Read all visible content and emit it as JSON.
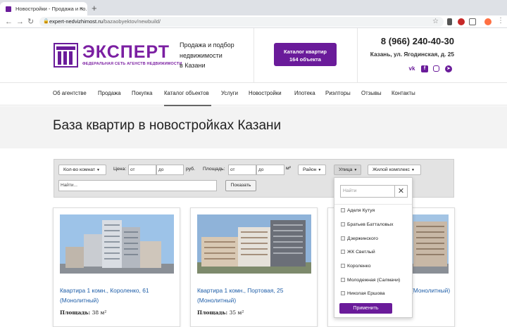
{
  "browser": {
    "tab_title": "Новостройки - Продажа и по...",
    "tab_close": "×",
    "new_tab": "+",
    "url_host": "expert-nedvizhimost.ru",
    "url_path": "/bazaobyektov/newbuild/"
  },
  "header": {
    "logo_name": "ЭКСПЕРТ",
    "logo_subtitle": "ФЕДЕРАЛЬНАЯ СЕТЬ АГЕНСТВ НЕДВИЖИМОСТИ",
    "tagline_1": "Продажа и подбор",
    "tagline_2": "недвижимости",
    "tagline_3": "в Казани",
    "catalog_line1": "Каталог квартир",
    "catalog_line2": "164 объекта",
    "phone": "8 (966) 240-40-30",
    "address": "Казань, ул. Ягодинская, д. 25",
    "brand_color": "#6a1b9a"
  },
  "menu": {
    "items": [
      {
        "label": "Об агентстве"
      },
      {
        "label": "Продажа"
      },
      {
        "label": "Покупка"
      },
      {
        "label": "Каталог объектов"
      },
      {
        "label": "Услуги"
      },
      {
        "label": "Новостройки"
      },
      {
        "label": "Ипотека"
      },
      {
        "label": "Риэлторы"
      },
      {
        "label": "Отзывы"
      },
      {
        "label": "Контакты"
      }
    ]
  },
  "page_title": "База квартир в новостройках Казани",
  "filter": {
    "rooms": "Кол-во комнат",
    "price_label": "Цена:",
    "price_from": "от",
    "price_to": "до",
    "price_unit": "руб.",
    "area_label": "Площадь:",
    "area_from": "от",
    "area_to": "до",
    "area_unit": "м²",
    "district": "Район",
    "street": "Улица",
    "complex": "Жилой комплекс",
    "search_placeholder": "Найти...",
    "show_button": "Показать"
  },
  "street_dropdown": {
    "search_placeholder": "Найти",
    "clear": "✕",
    "items": [
      {
        "label": "Аделя Кутуя"
      },
      {
        "label": "Братьев Батталовых"
      },
      {
        "label": "Дзержинского"
      },
      {
        "label": "ЖК Светлый"
      },
      {
        "label": "Короленко"
      },
      {
        "label": "Молодежная (Салмачи)"
      },
      {
        "label": "Николая Ершова"
      }
    ],
    "apply": "Применить"
  },
  "listings": [
    {
      "title": "Квартира 1 комн., Короленко, 61 (Монолитный)",
      "area_label": "Площадь:",
      "area_value": "38 м²"
    },
    {
      "title": "Квартира 1 комн., Портовая, 25 (Монолитный)",
      "area_label": "Площадь:",
      "area_value": "35 м²"
    },
    {
      "title": "(Монолитный)",
      "area_label": "",
      "area_value": ""
    }
  ]
}
